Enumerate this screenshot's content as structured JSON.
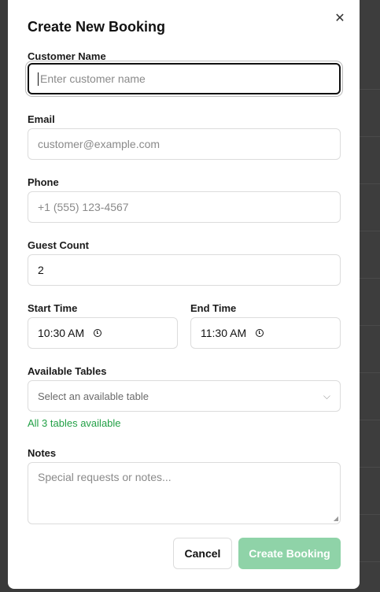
{
  "dialog": {
    "title": "Create New Booking",
    "close_icon": "close-icon"
  },
  "form": {
    "customer_name": {
      "label": "Customer Name",
      "placeholder": "Enter customer name",
      "value": ""
    },
    "email": {
      "label": "Email",
      "placeholder": "customer@example.com",
      "value": ""
    },
    "phone": {
      "label": "Phone",
      "placeholder": "+1 (555) 123-4567",
      "value": ""
    },
    "guest_count": {
      "label": "Guest Count",
      "value": "2"
    },
    "start_time": {
      "label": "Start Time",
      "value": "10:30 AM"
    },
    "end_time": {
      "label": "End Time",
      "value": "11:30 AM"
    },
    "tables": {
      "label": "Available Tables",
      "placeholder": "Select an available table",
      "availability": "All 3 tables available"
    },
    "notes": {
      "label": "Notes",
      "placeholder": "Special requests or notes..."
    }
  },
  "actions": {
    "cancel_label": "Cancel",
    "create_label": "Create Booking"
  },
  "colors": {
    "available_text": "#22a046",
    "create_button_disabled": "#8fd3a8"
  }
}
